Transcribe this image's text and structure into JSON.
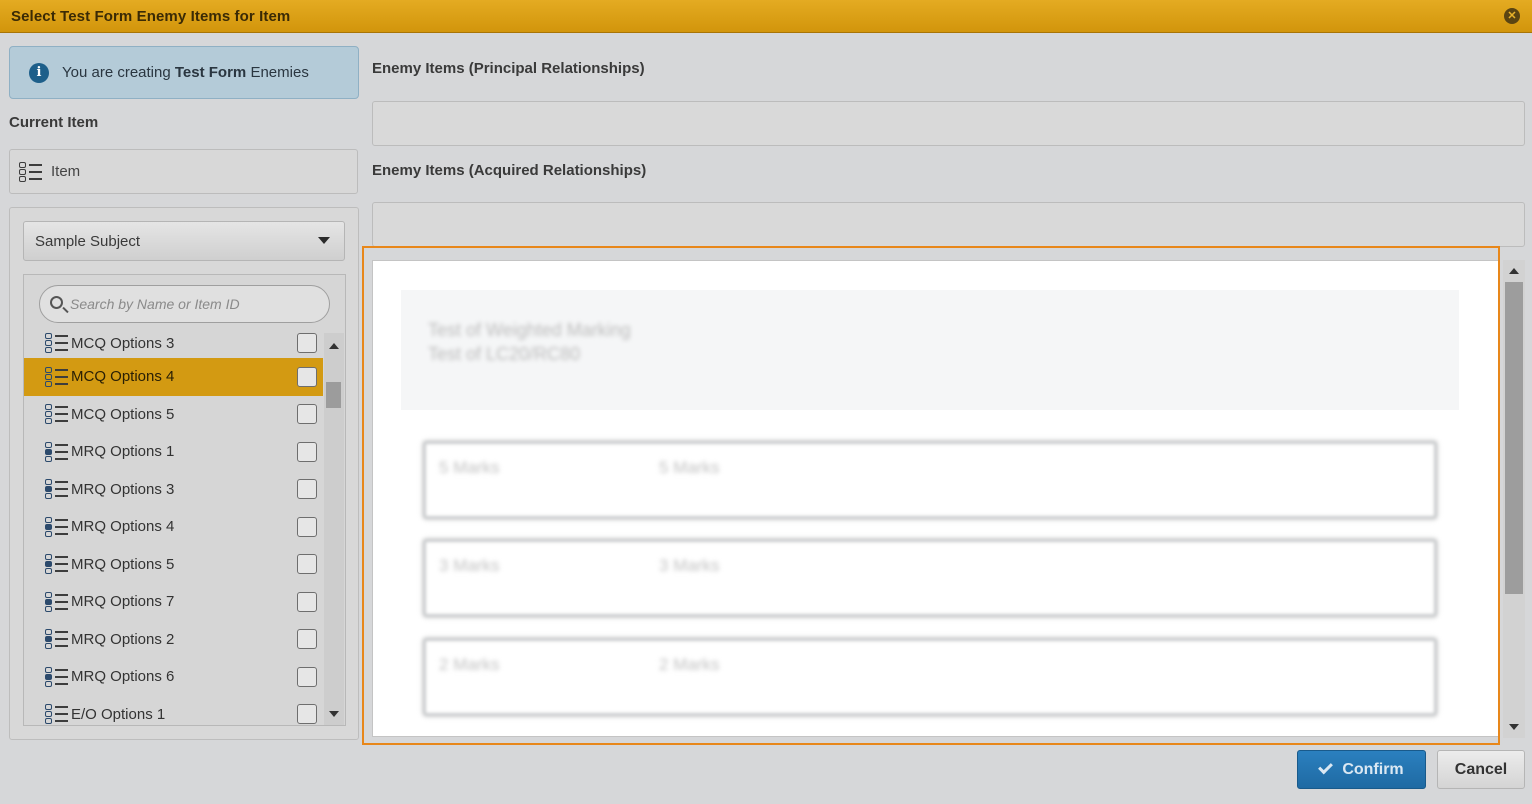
{
  "dialog": {
    "title": "Select Test Form Enemy Items for Item",
    "close_icon": "close-icon"
  },
  "info": {
    "prefix": "You are creating",
    "bold": "Test Form",
    "suffix": "Enemies"
  },
  "current_item": {
    "label": "Current Item",
    "value": "Item"
  },
  "subject_select": {
    "value": "Sample Subject"
  },
  "search": {
    "placeholder": "Search by Name or Item ID"
  },
  "items": [
    {
      "label": "MCQ Options 3",
      "type": "mcq",
      "selected": false
    },
    {
      "label": "MCQ Options 4",
      "type": "mcq",
      "selected": true
    },
    {
      "label": "MCQ Options 5",
      "type": "mcq",
      "selected": false
    },
    {
      "label": "MRQ Options 1",
      "type": "mrq",
      "selected": false
    },
    {
      "label": "MRQ Options 3",
      "type": "mrq",
      "selected": false
    },
    {
      "label": "MRQ Options 4",
      "type": "mrq",
      "selected": false
    },
    {
      "label": "MRQ Options 5",
      "type": "mrq",
      "selected": false
    },
    {
      "label": "MRQ Options 7",
      "type": "mrq",
      "selected": false
    },
    {
      "label": "MRQ Options 2",
      "type": "mrq",
      "selected": false
    },
    {
      "label": "MRQ Options 6",
      "type": "mrq",
      "selected": false
    },
    {
      "label": "E/O Options 1",
      "type": "mcq",
      "selected": false
    }
  ],
  "principal": {
    "label": "Enemy Items (Principal Relationships)"
  },
  "acquired": {
    "label": "Enemy Items (Acquired Relationships)"
  },
  "preview": {
    "line1": "Test of Weighted Marking",
    "line2": "Test of LC20/RC80",
    "rows": [
      {
        "a": "5 Marks",
        "b": "5 Marks"
      },
      {
        "a": "3 Marks",
        "b": "3 Marks"
      },
      {
        "a": "2 Marks",
        "b": "2 Marks"
      }
    ]
  },
  "buttons": {
    "confirm": "Confirm",
    "cancel": "Cancel"
  },
  "colors": {
    "titlebar": "#d9a016",
    "selected_row": "#d39a12",
    "confirm": "#2575b2",
    "highlight_border": "#e8871a"
  }
}
